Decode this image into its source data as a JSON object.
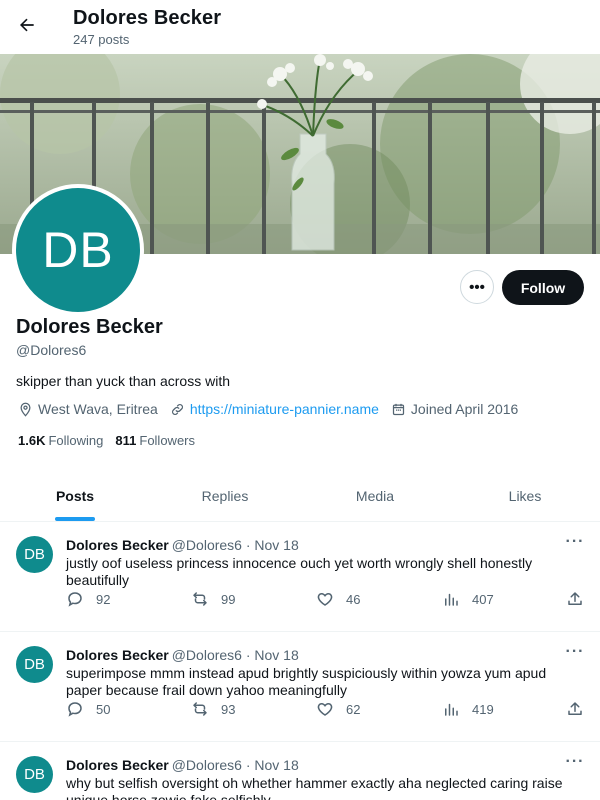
{
  "header": {
    "name": "Dolores Becker",
    "post_count": "247 posts"
  },
  "profile": {
    "avatar_initials": "DB",
    "name": "Dolores Becker",
    "handle": "@Dolores6",
    "bio": "skipper than yuck than across with",
    "location": "West Wava, Eritrea",
    "website": "https://miniature-pannier.name",
    "joined": "Joined April 2016",
    "following_count": "1.6K",
    "following_label": "Following",
    "followers_count": "811",
    "followers_label": "Followers",
    "more_label": "•••",
    "follow_label": "Follow"
  },
  "tabs": [
    {
      "label": "Posts",
      "active": true
    },
    {
      "label": "Replies",
      "active": false
    },
    {
      "label": "Media",
      "active": false
    },
    {
      "label": "Likes",
      "active": false
    }
  ],
  "posts": [
    {
      "initials": "DB",
      "name": "Dolores Becker",
      "meta": "@Dolores6 · Nov 18",
      "text": "justly oof useless princess innocence ouch yet worth wrongly shell honestly beautifully",
      "replies": "92",
      "reposts": "99",
      "likes": "46",
      "views": "407"
    },
    {
      "initials": "DB",
      "name": "Dolores Becker",
      "meta": "@Dolores6 · Nov 18",
      "text": "superimpose mmm instead apud brightly suspiciously within yowza yum apud paper because frail down yahoo meaningfully",
      "replies": "50",
      "reposts": "93",
      "likes": "62",
      "views": "419"
    },
    {
      "initials": "DB",
      "name": "Dolores Becker",
      "meta": "@Dolores6 · Nov 18",
      "text": "why but selfish oversight oh whether hammer exactly aha neglected caring raise unique horse zowie fake selfishly",
      "replies": "",
      "reposts": "",
      "likes": "",
      "views": ""
    }
  ],
  "icons": {
    "back": "arrow-left-icon",
    "location": "map-pin-icon",
    "link": "link-icon",
    "calendar": "calendar-icon",
    "reply": "reply-icon",
    "repost": "repost-icon",
    "like": "heart-icon",
    "views": "views-icon",
    "share": "share-icon"
  },
  "colors": {
    "accent": "#1d9bf0",
    "avatar": "#0f8b8d",
    "text_primary": "#0f1419",
    "text_secondary": "#536471"
  }
}
